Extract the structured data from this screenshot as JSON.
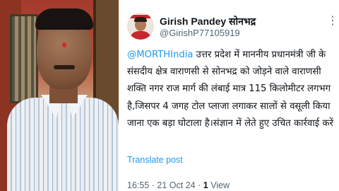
{
  "tweet": {
    "display_name": "Girish Pandey सोनभद्र",
    "handle": "@GirishP77105919",
    "mention": "@MORTHIndia",
    "text": " उत्तर प्रदेश में माननीय प्रधानमंत्री जी के संसदीय क्षेत्र वाराणसी से सोनभद्र को जोड़ने वाले वाराणसी शक्ति नगर राज मार्ग की लंबाई मात्र 115 किलोमीटर लगभग है,जिसपर 4 जगह टोल प्लाजा लगाकर सालों से वसूली किया जाना एक बड़ा घोटाला है।संज्ञान में लेते हुए उचित कार्रवाई करें",
    "translate_label": "Translate post",
    "time": "16:55",
    "separator": "·",
    "date": "21 Oct 24",
    "views_count": "1",
    "views_label": "View"
  },
  "icons": {
    "more": "more-options-icon",
    "avatar": "profile-avatar"
  },
  "colors": {
    "link": "#1d9bf0",
    "text": "#0f1419",
    "secondary": "#536471"
  }
}
